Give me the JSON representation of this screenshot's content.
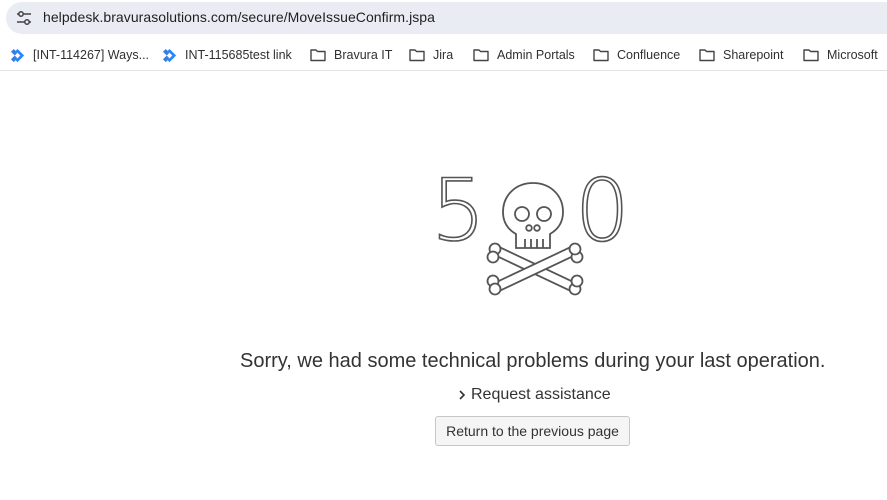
{
  "browser": {
    "url": "helpdesk.bravurasolutions.com/secure/MoveIssueConfirm.jspa",
    "site_info_icon": "tune-icon"
  },
  "bookmarks": [
    {
      "label": "[INT-114267] Ways...",
      "icon": "jira-icon"
    },
    {
      "label": "INT-115685test link",
      "icon": "jira-icon"
    },
    {
      "label": "Bravura IT",
      "icon": "folder-icon"
    },
    {
      "label": "Jira",
      "icon": "folder-icon"
    },
    {
      "label": "Admin Portals",
      "icon": "folder-icon"
    },
    {
      "label": "Confluence",
      "icon": "folder-icon"
    },
    {
      "label": "Sharepoint",
      "icon": "folder-icon"
    },
    {
      "label": "Microsoft",
      "icon": "folder-icon"
    }
  ],
  "error": {
    "code_left": "5",
    "code_right": "0",
    "illustration": "skull-crossbones-icon",
    "message": "Sorry, we had some technical problems during your last operation.",
    "assist_link": "Request assistance",
    "return_button": "Return to the previous page"
  },
  "colors": {
    "jira_blue": "#2684ff",
    "text": "#333333",
    "address_bar_bg": "#e9ecf3"
  }
}
